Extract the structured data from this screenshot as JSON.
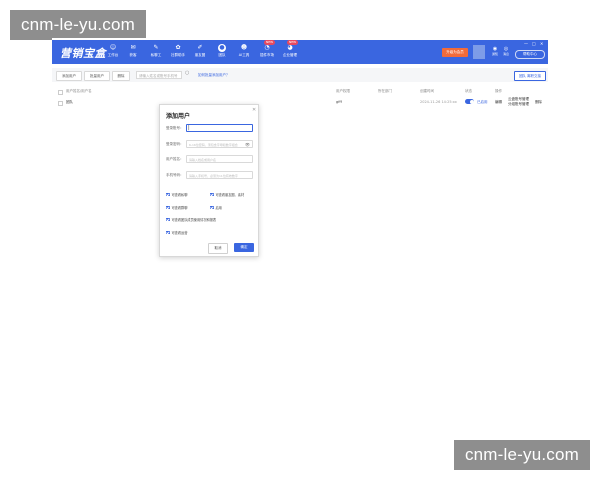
{
  "watermark": {
    "text": "cnm-le-yu.com"
  },
  "app": {
    "logo": "营销宝盒",
    "nav": [
      {
        "icon": "☺",
        "label": "工作台"
      },
      {
        "icon": "✉",
        "label": "获客"
      },
      {
        "icon": "✎",
        "label": "私聊工"
      },
      {
        "icon": "✿",
        "label": "社群助手"
      },
      {
        "icon": "✐",
        "label": "朋友圈"
      },
      {
        "icon": "●",
        "label": "团队"
      },
      {
        "icon": "☻",
        "label": "AI工具"
      },
      {
        "icon": "◔",
        "label": "插件市场",
        "badge": "NEW"
      },
      {
        "icon": "◕",
        "label": "企业管理",
        "badge": "NEW"
      }
    ],
    "promo": "升级为会员",
    "top_icons": [
      {
        "icon": "◉",
        "label": "通知"
      },
      {
        "icon": "◎",
        "label": "消息"
      }
    ],
    "help": "帮助中心",
    "window": {
      "minimize": "—",
      "maximize": "□",
      "close": "✕"
    }
  },
  "toolbar": {
    "add_user": "添加用户",
    "batch": "批量用户",
    "delete": "删除",
    "search_placeholder": "请输入姓名或账号手机号",
    "help_link": "如何批量添加用户？",
    "right_link": "团队 离职交接"
  },
  "table": {
    "headers": [
      "用户姓名/用户名",
      "用户权限",
      "所在部门",
      "创建时间",
      "状态",
      "操作"
    ],
    "row": {
      "name": "团队",
      "permission": "gfff",
      "created": "2024-11-26 14:25:xx",
      "status": "已启用",
      "action_edit": "编辑",
      "action_manage_1": "云盘账号管理",
      "action_manage_2": "分组账号管理",
      "action_delete": "删除"
    }
  },
  "modal": {
    "title": "添加用户",
    "close": "✕",
    "fields": [
      {
        "label": "登录账号：",
        "placeholder": "",
        "focused": true
      },
      {
        "label": "登录密码：",
        "placeholder": "6-16位密码，须包含字母和数字组合",
        "eye": "👁"
      },
      {
        "label": "用户姓名：",
        "placeholder": "请输入姓名或用户名"
      },
      {
        "label": "手机号码：",
        "placeholder": "请输入手机号，必须为11位有效数字"
      }
    ],
    "checkboxes": [
      {
        "label": "可查看私聊"
      },
      {
        "label": "可查看朋友圈、素材"
      },
      {
        "label": "可查看群聊"
      },
      {
        "label": "启用"
      },
      {
        "label": "可查看团队成员使用情况和报表"
      },
      {
        "label": "可查看运营"
      }
    ],
    "cancel": "取消",
    "confirm": "确定"
  }
}
